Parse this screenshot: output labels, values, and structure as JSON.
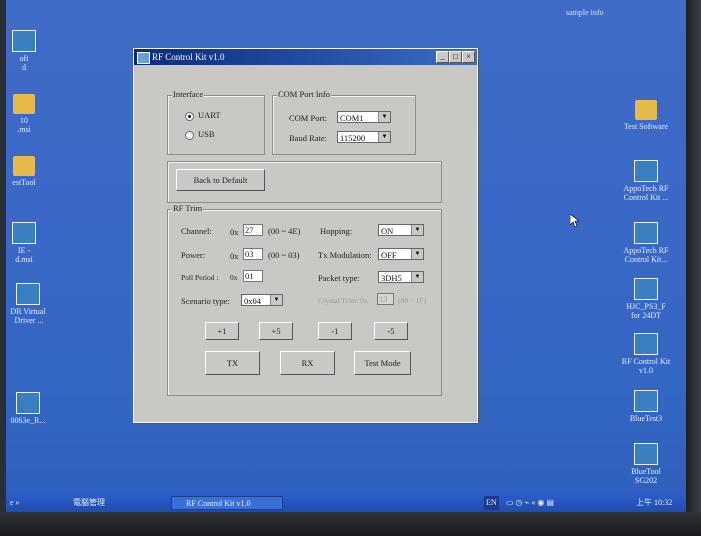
{
  "desktop": {
    "top_text": "sample info",
    "left_icons": [
      {
        "label": "oft\nd",
        "kind": "app"
      },
      {
        "label": "10\n.msi",
        "kind": "folder"
      },
      {
        "label": "estTool",
        "kind": "folder"
      },
      {
        "label": "IE -\nd.msi",
        "kind": "app"
      },
      {
        "label": "DR Virtual\n Driver ...",
        "kind": "app"
      },
      {
        "label": "0063e_R...",
        "kind": "app"
      }
    ],
    "right_icons": [
      {
        "label": "Test Software",
        "kind": "folder"
      },
      {
        "label": "AppoTech RF\nControl Kit ...",
        "kind": "app"
      },
      {
        "label": "AppoTech RF\nControl Kit...",
        "kind": "app"
      },
      {
        "label": "HJC_PS3_F\nfor 24DT",
        "kind": "app"
      },
      {
        "label": "RF Control Kit\nv1.0",
        "kind": "app"
      },
      {
        "label": "BlueTest3",
        "kind": "app"
      },
      {
        "label": "BlueTool\nSG202",
        "kind": "app"
      }
    ]
  },
  "window": {
    "title": "RF Control Kit v1.0",
    "interface": {
      "caption": "Interface",
      "options": [
        {
          "label": "UART",
          "selected": true
        },
        {
          "label": "USB",
          "selected": false
        }
      ]
    },
    "com_port_info": {
      "caption": "COM Port Info",
      "com_port_label": "COM Port:",
      "com_port_value": "COM1",
      "baud_rate_label": "Baud Rate:",
      "baud_rate_value": "115200"
    },
    "back_to_default": "Back to Default",
    "rf_trim": {
      "caption": "RF Trim",
      "channel_label": "Channel:",
      "channel_prefix": "0x",
      "channel_value": "27",
      "channel_range": "(00 ~ 4E)",
      "power_label": "Power:",
      "power_prefix": "0x",
      "power_value": "03",
      "power_range": "(00 ~ 03)",
      "poll_label": "Poll Period :",
      "poll_prefix": "0x",
      "poll_value": "01",
      "scenario_label": "Scenario type:",
      "scenario_value": "0x04",
      "hopping_label": "Hopping:",
      "hopping_value": "ON",
      "txmod_label": "Tx Modulation:",
      "txmod_value": "OFF",
      "packet_label": "Packet type:",
      "packet_value": "3DH5",
      "crystal_label": "Crystal Trim: 0x",
      "crystal_value": "13",
      "crystal_range": "(00 ~ 1F)",
      "step_buttons": [
        "+1",
        "+5",
        "-1",
        "-5"
      ],
      "action_buttons": [
        "TX",
        "RX",
        "Test Mode"
      ]
    }
  },
  "taskbar": {
    "quick_launch": "e »",
    "items": [
      "電腦管理",
      "RF Control Kit v1.0"
    ],
    "lang": "EN",
    "clock": "上午 10:32"
  }
}
